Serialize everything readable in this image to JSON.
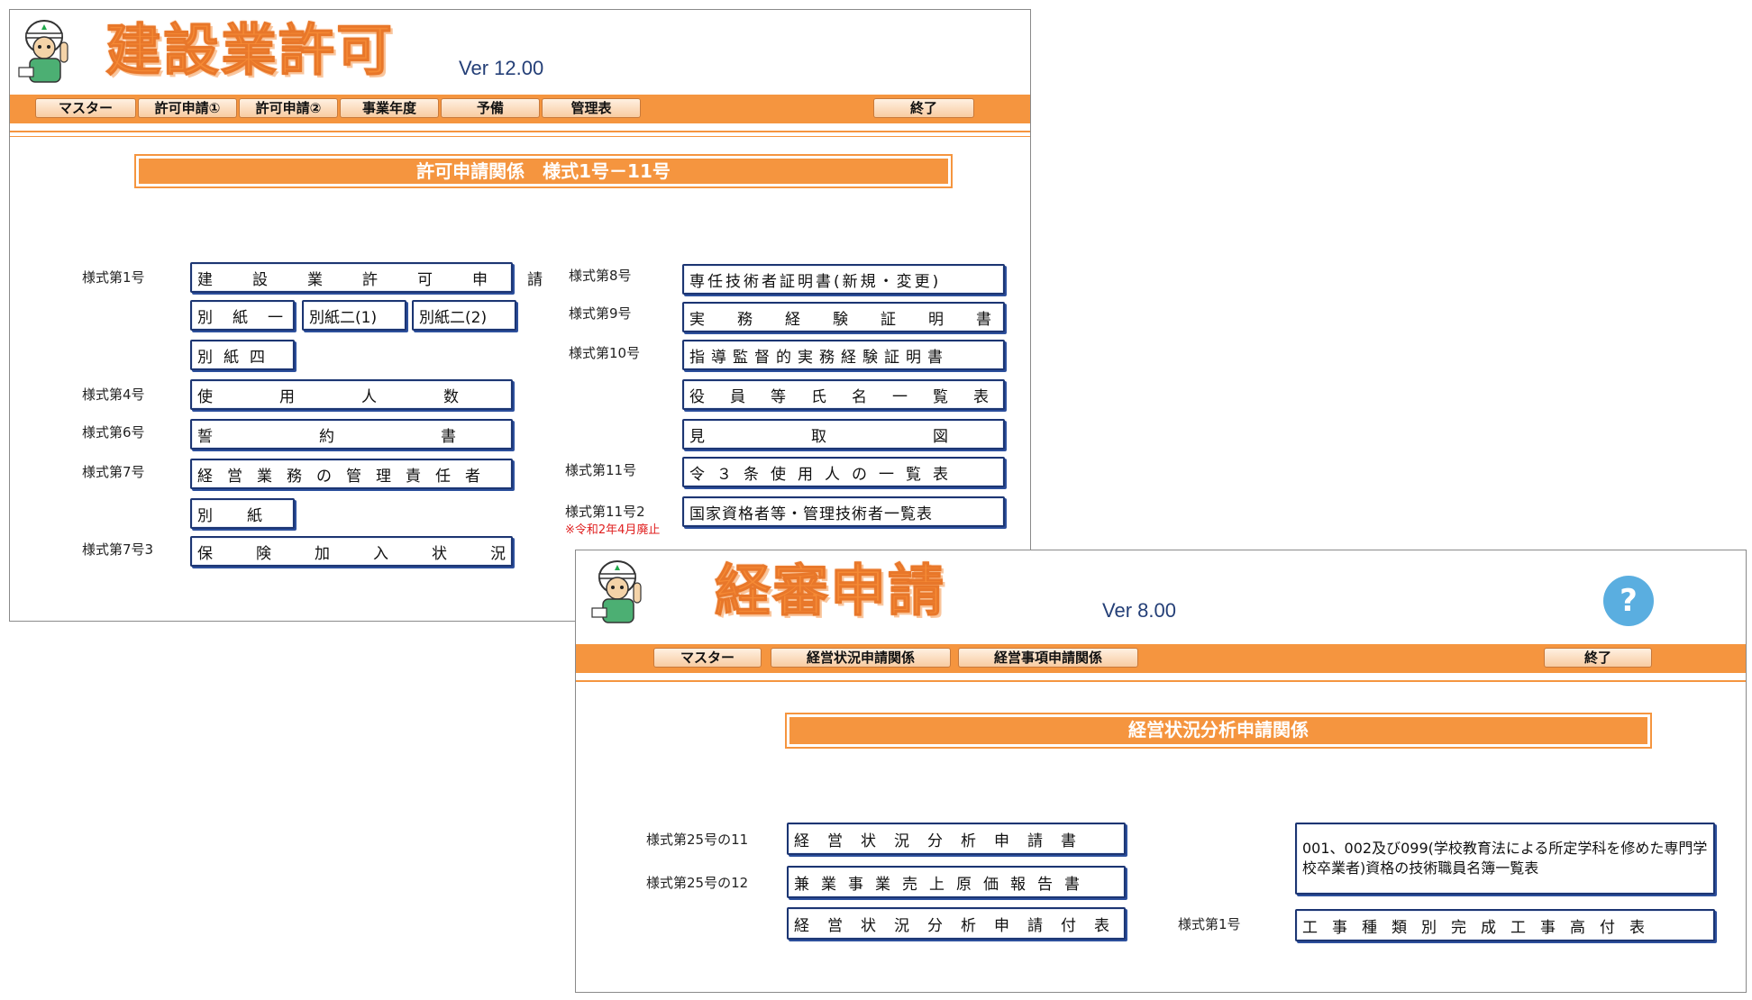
{
  "window1": {
    "app_title": "建設業許可",
    "version": "Ver 12.00",
    "menu": [
      "マスター",
      "許可申請①",
      "許可申請②",
      "事業年度",
      "予備",
      "管理表"
    ],
    "exit_label": "終了",
    "section_title": "許可申請関係　様式1号－11号",
    "labels": {
      "f1": "様式第1号",
      "f4": "様式第4号",
      "f6": "様式第6号",
      "f7": "様式第7号",
      "f7_3": "様式第7号3",
      "f8": "様式第8号",
      "f9": "様式第9号",
      "f10": "様式第10号",
      "f11": "様式第11号",
      "f11_2": "様式第11号2",
      "note_abolished": "※令和2年4月廃止"
    },
    "buttons": {
      "kensetsu_kyoka_shinsei": "建設業許可申請",
      "besshi_1": "別紙一",
      "besshi_2_1": "別紙二(1)",
      "besshi_2_2": "別紙二(2)",
      "besshi_4": "別紙四",
      "shiyounin_suu": "使用人数",
      "seiyakusho": "誓約書",
      "keiei_sekininsha": "経営業務の管理責任者",
      "besshi": "別紙",
      "hoken_kanyu": "保険加入状況",
      "sennin_gijutsusha": "専任技術者証明書(新規・変更)",
      "jitsumu_keiken": "実務経験証明書",
      "shidou_kantoku": "指導監督的実務経験証明書",
      "yakuin_ichiran": "役員等氏名一覧表",
      "mitorizu": "見取図",
      "rei3jou": "令３条使用人の一覧表",
      "kokka_shikaku": "国家資格者等・管理技術者一覧表"
    }
  },
  "window2": {
    "app_title": "経審申請",
    "version": "Ver 8.00",
    "help_label": "?",
    "menu": [
      "マスター",
      "経営状況申請関係",
      "経営事項申請関係"
    ],
    "exit_label": "終了",
    "section_title": "経営状況分析申請関係",
    "labels": {
      "f25_11": "様式第25号の11",
      "f25_12": "様式第25号の12",
      "f1": "様式第1号"
    },
    "buttons": {
      "keiei_joukyou_shinsei": "経営状況分析申請書",
      "kengyou_jigyou": "兼業事業売上原価報告書",
      "keiei_fuhyou": "経営状況分析申請付表",
      "gijutsu_meibo": "001、002及び099(学校教育法による所定学科を修めた専門学校卒業者)資格の技術職員名簿一覧表",
      "kanseikoji": "工事種類別完成工事高付表"
    }
  }
}
